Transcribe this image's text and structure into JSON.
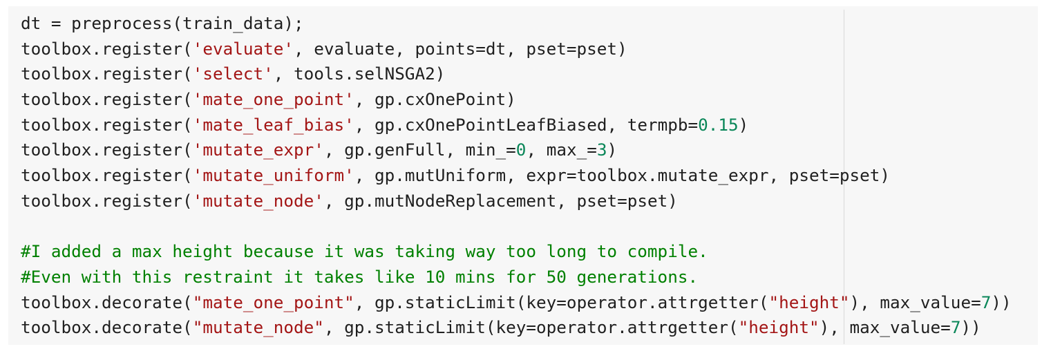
{
  "code_cell": {
    "lines": [
      [
        {
          "t": "plain",
          "v": "dt = preprocess(train_data);"
        }
      ],
      [
        {
          "t": "plain",
          "v": "toolbox.register("
        },
        {
          "t": "str",
          "v": "'evaluate'"
        },
        {
          "t": "plain",
          "v": ", evaluate, points=dt, pset=pset)"
        }
      ],
      [
        {
          "t": "plain",
          "v": "toolbox.register("
        },
        {
          "t": "str",
          "v": "'select'"
        },
        {
          "t": "plain",
          "v": ", tools.selNSGA2)"
        }
      ],
      [
        {
          "t": "plain",
          "v": "toolbox.register("
        },
        {
          "t": "str",
          "v": "'mate_one_point'"
        },
        {
          "t": "plain",
          "v": ", gp.cxOnePoint)"
        }
      ],
      [
        {
          "t": "plain",
          "v": "toolbox.register("
        },
        {
          "t": "str",
          "v": "'mate_leaf_bias'"
        },
        {
          "t": "plain",
          "v": ", gp.cxOnePointLeafBiased, termpb="
        },
        {
          "t": "num",
          "v": "0.15"
        },
        {
          "t": "plain",
          "v": ")"
        }
      ],
      [
        {
          "t": "plain",
          "v": "toolbox.register("
        },
        {
          "t": "str",
          "v": "'mutate_expr'"
        },
        {
          "t": "plain",
          "v": ", gp.genFull, min_="
        },
        {
          "t": "num",
          "v": "0"
        },
        {
          "t": "plain",
          "v": ", max_="
        },
        {
          "t": "num",
          "v": "3"
        },
        {
          "t": "plain",
          "v": ")"
        }
      ],
      [
        {
          "t": "plain",
          "v": "toolbox.register("
        },
        {
          "t": "str",
          "v": "'mutate_uniform'"
        },
        {
          "t": "plain",
          "v": ", gp.mutUniform, expr=toolbox.mutate_expr, pset=pset)"
        }
      ],
      [
        {
          "t": "plain",
          "v": "toolbox.register("
        },
        {
          "t": "str",
          "v": "'mutate_node'"
        },
        {
          "t": "plain",
          "v": ", gp.mutNodeReplacement, pset=pset)"
        }
      ],
      [],
      [
        {
          "t": "com",
          "v": "#I added a max height because it was taking way too long to compile."
        }
      ],
      [
        {
          "t": "com",
          "v": "#Even with this restraint it takes like 10 mins for 50 generations."
        }
      ],
      [
        {
          "t": "plain",
          "v": "toolbox.decorate("
        },
        {
          "t": "str",
          "v": "\"mate_one_point\""
        },
        {
          "t": "plain",
          "v": ", gp.staticLimit(key=operator.attrgetter("
        },
        {
          "t": "str",
          "v": "\"height\""
        },
        {
          "t": "plain",
          "v": "), max_value="
        },
        {
          "t": "num",
          "v": "7"
        },
        {
          "t": "plain",
          "v": "))"
        }
      ],
      [
        {
          "t": "plain",
          "v": "toolbox.decorate("
        },
        {
          "t": "str",
          "v": "\"mutate_node\""
        },
        {
          "t": "plain",
          "v": ", gp.staticLimit(key=operator.attrgetter("
        },
        {
          "t": "str",
          "v": "\"height\""
        },
        {
          "t": "plain",
          "v": "), max_value="
        },
        {
          "t": "num",
          "v": "7"
        },
        {
          "t": "plain",
          "v": "))"
        }
      ]
    ]
  },
  "colors": {
    "background": "#f7f7f7",
    "text": "#1f1f1f",
    "string": "#a31515",
    "number": "#098658",
    "comment": "#008000",
    "ruler": "#d9d9d9"
  }
}
